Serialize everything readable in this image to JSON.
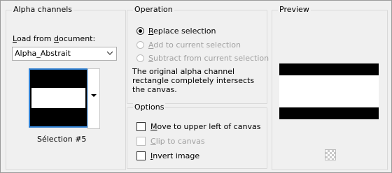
{
  "alpha_channels": {
    "title": "Alpha channels",
    "load_from_label": "Load from document:",
    "document_value": "Alpha_Abstrait",
    "selection_label": "Sélection #5"
  },
  "operation": {
    "title": "Operation",
    "options": [
      {
        "label": "Replace selection",
        "checked": true,
        "enabled": true
      },
      {
        "label": "Add to current selection",
        "checked": false,
        "enabled": false
      },
      {
        "label": "Subtract from current selection",
        "checked": false,
        "enabled": false
      }
    ],
    "description": "The original alpha channel rectangle completely intersects the canvas."
  },
  "options": {
    "title": "Options",
    "items": [
      {
        "label": "Move to upper left of canvas",
        "checked": false,
        "enabled": true
      },
      {
        "label": "Clip to canvas",
        "checked": false,
        "enabled": false
      },
      {
        "label": "Invert image",
        "checked": false,
        "enabled": true
      }
    ]
  },
  "preview": {
    "title": "Preview"
  },
  "colors": {
    "accent": "#2f7fd1",
    "dialog_bg": "#f0f0f0",
    "disabled_text": "#a0a0a0"
  }
}
